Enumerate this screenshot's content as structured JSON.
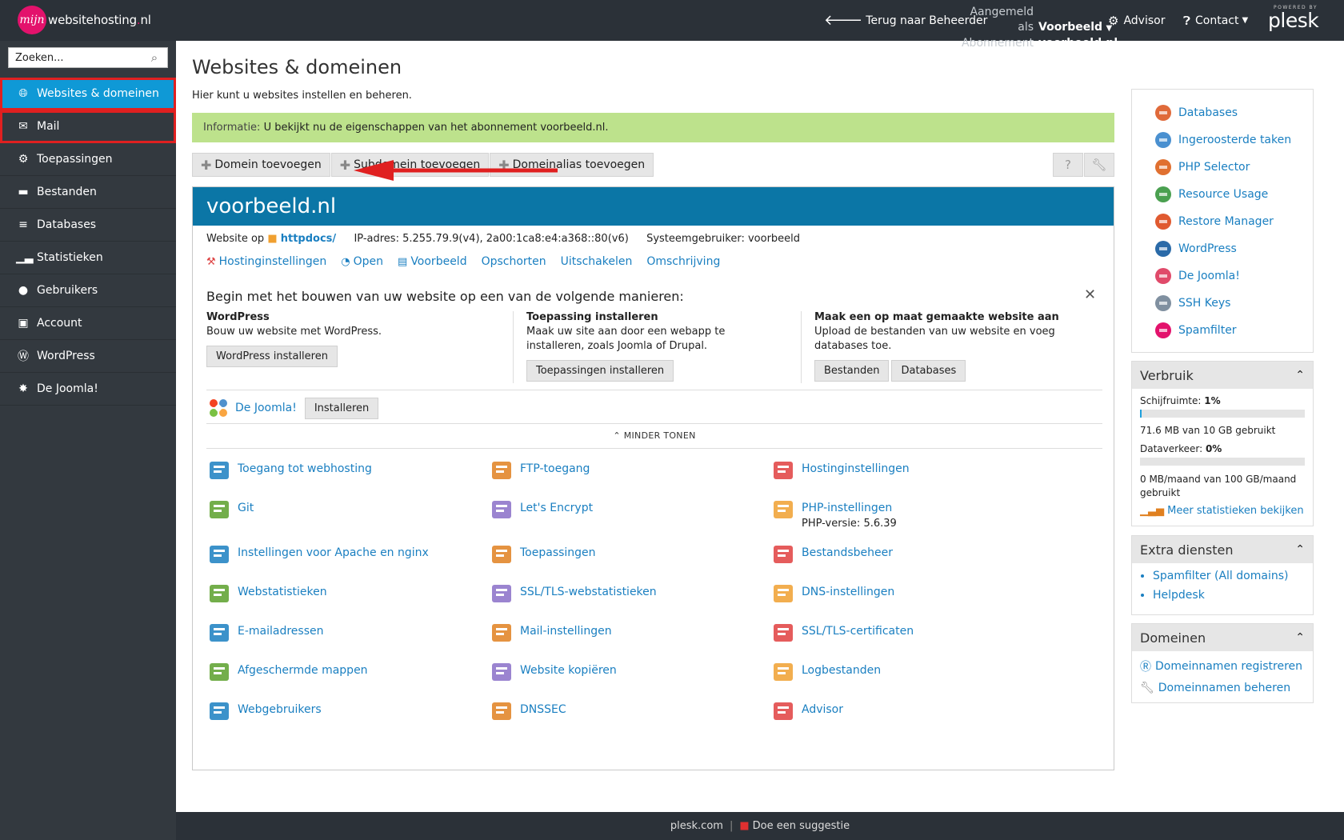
{
  "header": {
    "logo_badge": "mijn",
    "logo_brand": "websitehosting",
    "logo_dot": ".",
    "logo_tld": "nl",
    "back_label": "Terug naar Beheerder",
    "logged_in_label": "Aangemeld als",
    "logged_in_user": "Voorbeeld",
    "subscription_label": "Abonnement",
    "subscription_value": "voorbeeld.nl",
    "advisor_label": "Advisor",
    "contact_label": "Contact",
    "powered_by": "POWERED BY",
    "plesk": "plesk"
  },
  "sidebar": {
    "search_placeholder": "Zoeken...",
    "items": [
      {
        "label": "Websites & domeinen",
        "icon": "globe-icon"
      },
      {
        "label": "Mail",
        "icon": "mail-icon"
      },
      {
        "label": "Toepassingen",
        "icon": "gear-icon"
      },
      {
        "label": "Bestanden",
        "icon": "folder-icon"
      },
      {
        "label": "Databases",
        "icon": "database-icon"
      },
      {
        "label": "Statistieken",
        "icon": "bar-chart-icon"
      },
      {
        "label": "Gebruikers",
        "icon": "user-icon"
      },
      {
        "label": "Account",
        "icon": "id-card-icon"
      },
      {
        "label": "WordPress",
        "icon": "wordpress-icon"
      },
      {
        "label": "De Joomla!",
        "icon": "joomla-icon"
      }
    ]
  },
  "main": {
    "title": "Websites & domeinen",
    "description": "Hier kunt u websites instellen en beheren.",
    "info_prefix": "Informatie:",
    "info_text": "U bekijkt nu de eigenschappen van het abonnement voorbeeld.nl.",
    "toolbar": {
      "add_domain": "Domein toevoegen",
      "add_subdomain": "Subdomein toevoegen",
      "add_alias": "Domeinalias toevoegen"
    }
  },
  "domain": {
    "name": "voorbeeld.nl",
    "website_label": "Website op",
    "docroot": "httpdocs/",
    "ip_label": "IP-adres:",
    "ip_value": "5.255.79.9(v4), 2a00:1ca8:e4:a368::80(v6)",
    "sysuser_label": "Systeemgebruiker:",
    "sysuser_value": "voorbeeld",
    "actions": [
      "Hostinginstellingen",
      "Open",
      "Voorbeeld",
      "Opschorten",
      "Uitschakelen",
      "Omschrijving"
    ],
    "start_title": "Begin met het bouwen van uw website op een van de volgende manieren:",
    "col1": {
      "heading": "WordPress",
      "desc": "Bouw uw website met WordPress.",
      "button": "WordPress installeren"
    },
    "col2": {
      "heading": "Toepassing installeren",
      "desc": "Maak uw site aan door een webapp te installeren, zoals Joomla of Drupal.",
      "button": "Toepassingen installeren"
    },
    "col3": {
      "heading": "Maak een op maat gemaakte website aan",
      "desc": "Upload de bestanden van uw website en voeg databases toe.",
      "button1": "Bestanden",
      "button2": "Databases"
    },
    "joomla_link": "De Joomla!",
    "joomla_button": "Installeren",
    "show_less": "MINDER TONEN",
    "tools": [
      {
        "label": "Toegang tot webhosting",
        "icon": "webhosting-access-icon"
      },
      {
        "label": "FTP-toegang",
        "icon": "ftp-icon"
      },
      {
        "label": "Hostinginstellingen",
        "icon": "hosting-settings-icon"
      },
      {
        "label": "Git",
        "icon": "git-icon"
      },
      {
        "label": "Let's Encrypt",
        "icon": "lets-encrypt-icon"
      },
      {
        "label": "PHP-instellingen",
        "icon": "php-icon",
        "sub": "PHP-versie: 5.6.39"
      },
      {
        "label": "Instellingen voor Apache en nginx",
        "icon": "apache-nginx-icon"
      },
      {
        "label": "Toepassingen",
        "icon": "applications-icon"
      },
      {
        "label": "Bestandsbeheer",
        "icon": "file-manager-icon"
      },
      {
        "label": "Webstatistieken",
        "icon": "web-stats-icon"
      },
      {
        "label": "SSL/TLS-webstatistieken",
        "icon": "ssl-stats-icon"
      },
      {
        "label": "DNS-instellingen",
        "icon": "dns-icon"
      },
      {
        "label": "E-mailadressen",
        "icon": "email-icon"
      },
      {
        "label": "Mail-instellingen",
        "icon": "mail-settings-icon"
      },
      {
        "label": "SSL/TLS-certificaten",
        "icon": "certificate-icon"
      },
      {
        "label": "Afgeschermde mappen",
        "icon": "protected-folder-icon"
      },
      {
        "label": "Website kopiëren",
        "icon": "copy-website-icon"
      },
      {
        "label": "Logbestanden",
        "icon": "log-files-icon"
      },
      {
        "label": "Webgebruikers",
        "icon": "web-users-icon"
      },
      {
        "label": "DNSSEC",
        "icon": "dnssec-icon"
      },
      {
        "label": "Advisor",
        "icon": "advisor-owl-icon"
      }
    ]
  },
  "right": {
    "quick_links": [
      "Databases",
      "Ingeroosterde taken",
      "PHP Selector",
      "Resource Usage",
      "Restore Manager",
      "WordPress",
      "De Joomla!",
      "SSH Keys",
      "Spamfilter"
    ],
    "usage": {
      "title": "Verbruik",
      "disk_label": "Schijfruimte:",
      "disk_percent": "1%",
      "disk_fraction": 0.01,
      "disk_detail": "71.6 MB van 10 GB gebruikt",
      "traffic_label": "Dataverkeer:",
      "traffic_percent": "0%",
      "traffic_fraction": 0,
      "traffic_detail": "0 MB/maand van 100 GB/maand gebruikt",
      "more_stats": "Meer statistieken bekijken"
    },
    "extra": {
      "title": "Extra diensten",
      "items": [
        "Spamfilter (All domains)",
        "Helpdesk"
      ]
    },
    "domains": {
      "title": "Domeinen",
      "register": "Domeinnamen registreren",
      "manage": "Domeinnamen beheren"
    }
  },
  "footer": {
    "site": "plesk.com",
    "sep": "|",
    "suggest": "Doe een suggestie"
  },
  "colors": {
    "header_bg": "#2b3138",
    "sidebar_bg": "#33393f",
    "active_nav": "#0f99d6",
    "domain_header": "#0b76a6",
    "info_bar": "#bde28c",
    "link": "#1a7fc1",
    "annotation_red": "#e02020"
  }
}
